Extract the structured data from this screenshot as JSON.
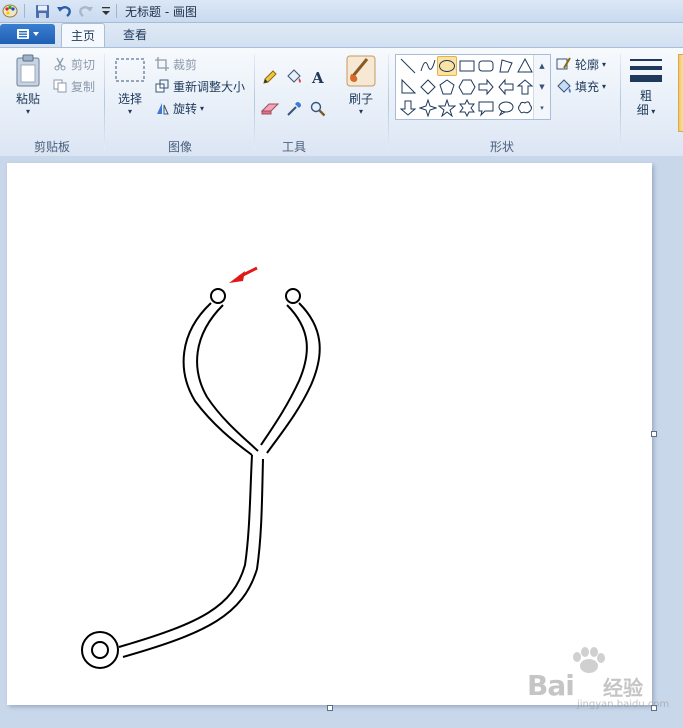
{
  "window": {
    "title": "无标题 - 画图"
  },
  "tabs": [
    {
      "label": "主页",
      "active": true
    },
    {
      "label": "查看",
      "active": false
    }
  ],
  "ribbon": {
    "clipboard": {
      "group_label": "剪贴板",
      "paste_label": "粘贴",
      "cut_label": "剪切",
      "copy_label": "复制"
    },
    "image": {
      "group_label": "图像",
      "select_label": "选择",
      "crop_label": "裁剪",
      "resize_label": "重新调整大小",
      "rotate_label": "旋转"
    },
    "tools": {
      "group_label": "工具",
      "brush_label": "刷子"
    },
    "shapes": {
      "group_label": "形状",
      "outline_label": "轮廓",
      "fill_label": "填充",
      "size_label_1": "粗",
      "size_label_2": "细"
    }
  },
  "watermark": {
    "brand": "Bai",
    "brand_cn": "经验",
    "url": "jingyan.baidu.com"
  },
  "colors": {
    "accent_red": "#e01818",
    "menu_blue": "#2a6cc4"
  }
}
